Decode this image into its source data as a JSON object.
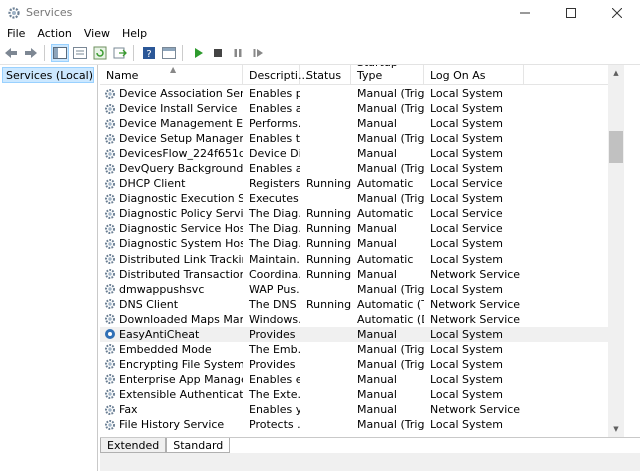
{
  "window": {
    "title": "Services"
  },
  "menu": [
    "File",
    "Action",
    "View",
    "Help"
  ],
  "tree": {
    "selected_label": "Services (Local)"
  },
  "table": {
    "columns": [
      "Name",
      "Descripti...",
      "Status",
      "Startup Type",
      "Log On As"
    ],
    "rows": [
      [
        "Device Association Service",
        "Enables p...",
        "",
        "Manual (Trig...",
        "Local System"
      ],
      [
        "Device Install Service",
        "Enables a...",
        "",
        "Manual (Trig...",
        "Local System"
      ],
      [
        "Device Management Enroll...",
        "Performs...",
        "",
        "Manual",
        "Local System"
      ],
      [
        "Device Setup Manager",
        "Enables t...",
        "",
        "Manual (Trig...",
        "Local System"
      ],
      [
        "DevicesFlow_224f651d",
        "Device Di...",
        "",
        "Manual",
        "Local System"
      ],
      [
        "DevQuery Background Disc...",
        "Enables a...",
        "",
        "Manual (Trig...",
        "Local System"
      ],
      [
        "DHCP Client",
        "Registers ...",
        "Running",
        "Automatic",
        "Local Service"
      ],
      [
        "Diagnostic Execution Service",
        "Executes ...",
        "",
        "Manual (Trig...",
        "Local System"
      ],
      [
        "Diagnostic Policy Service",
        "The Diag...",
        "Running",
        "Automatic",
        "Local Service"
      ],
      [
        "Diagnostic Service Host",
        "The Diag...",
        "Running",
        "Manual",
        "Local Service"
      ],
      [
        "Diagnostic System Host",
        "The Diag...",
        "Running",
        "Manual",
        "Local System"
      ],
      [
        "Distributed Link Tracking Cl...",
        "Maintain...",
        "Running",
        "Automatic",
        "Local System"
      ],
      [
        "Distributed Transaction Coo...",
        "Coordina...",
        "Running",
        "Manual",
        "Network Service"
      ],
      [
        "dmwappushsvc",
        "WAP Pus...",
        "",
        "Manual (Trig...",
        "Local System"
      ],
      [
        "DNS Client",
        "The DNS ...",
        "Running",
        "Automatic (T...",
        "Network Service"
      ],
      [
        "Downloaded Maps Manager",
        "Windows...",
        "",
        "Automatic (D...",
        "Network Service"
      ],
      [
        "EasyAntiCheat",
        "Provides ...",
        "",
        "Manual",
        "Local System"
      ],
      [
        "Embedded Mode",
        "The Emb...",
        "",
        "Manual (Trig...",
        "Local System"
      ],
      [
        "Encrypting File System (EFS)",
        "Provides ...",
        "",
        "Manual (Trig...",
        "Local System"
      ],
      [
        "Enterprise App Managemen...",
        "Enables e...",
        "",
        "Manual",
        "Local System"
      ],
      [
        "Extensible Authentication P...",
        "The Exte...",
        "",
        "Manual",
        "Local System"
      ],
      [
        "Fax",
        "Enables y...",
        "",
        "Manual",
        "Network Service"
      ],
      [
        "File History Service",
        "Protects ...",
        "",
        "Manual (Trig...",
        "Local System"
      ]
    ],
    "highlighted_row": "EasyAntiCheat"
  },
  "tabs": [
    "Extended",
    "Standard"
  ],
  "active_tab": "Standard"
}
